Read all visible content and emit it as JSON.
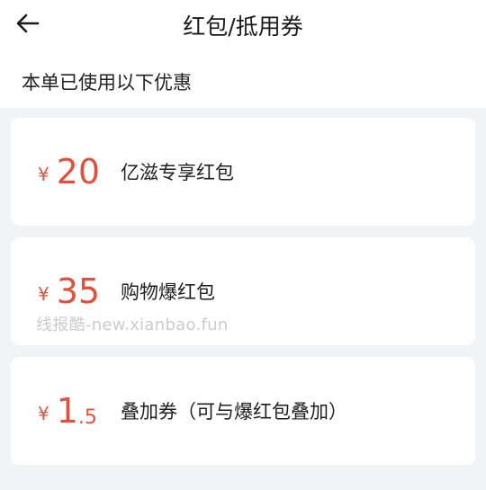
{
  "header": {
    "title": "红包/抵用券"
  },
  "subtitle": "本单已使用以下优惠",
  "coupons": [
    {
      "currency": "¥",
      "amount": "20",
      "name": "亿滋专享红包"
    },
    {
      "currency": "¥",
      "amount": "35",
      "name": "购物爆红包"
    },
    {
      "currency": "¥",
      "amount_int": "1",
      "amount_dec": ".5",
      "name": "叠加券（可与爆红包叠加）"
    }
  ],
  "watermark": "线报酷-new.xianbao.fun",
  "colors": {
    "price": "#e2503c",
    "background": "#f2f3f5"
  }
}
